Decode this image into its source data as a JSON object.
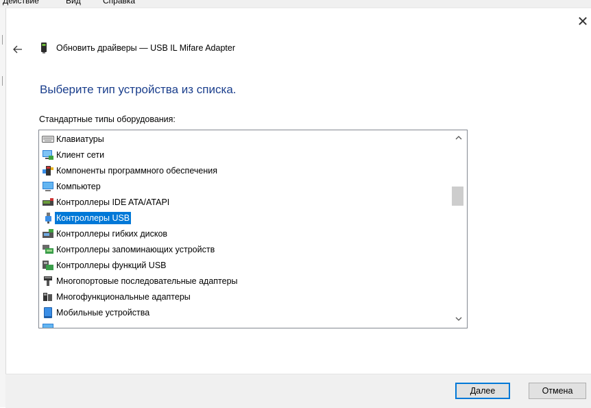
{
  "menubar": {
    "items": [
      "Действие",
      "Вид",
      "Справка"
    ]
  },
  "window": {
    "close_glyph": "✕"
  },
  "header": {
    "back_icon": "arrow-left-icon",
    "device_icon": "usb-device-icon",
    "title": "Обновить драйверы — USB IL Mifare Adapter"
  },
  "main": {
    "instruction": "Выберите тип устройства из списка.",
    "list_label": "Стандартные типы оборудования:",
    "selected_index": 5,
    "items": [
      {
        "label": "Клавиатуры",
        "icon": "keyboard-icon"
      },
      {
        "label": "Клиент сети",
        "icon": "network-client-icon"
      },
      {
        "label": "Компоненты программного обеспечения",
        "icon": "software-component-icon"
      },
      {
        "label": "Компьютер",
        "icon": "computer-icon"
      },
      {
        "label": "Контроллеры IDE ATA/ATAPI",
        "icon": "ide-controller-icon"
      },
      {
        "label": "Контроллеры USB",
        "icon": "usb-controller-icon"
      },
      {
        "label": "Контроллеры гибких дисков",
        "icon": "floppy-controller-icon"
      },
      {
        "label": "Контроллеры запоминающих устройств",
        "icon": "storage-controller-icon"
      },
      {
        "label": "Контроллеры функций USB",
        "icon": "usb-function-controller-icon"
      },
      {
        "label": "Многопортовые последовательные адаптеры",
        "icon": "multiport-serial-icon"
      },
      {
        "label": "Многофункциональные адаптеры",
        "icon": "multifunction-adapter-icon"
      },
      {
        "label": "Мобильные устройства",
        "icon": "mobile-device-icon"
      },
      {
        "label": "",
        "icon": "monitor-icon"
      }
    ]
  },
  "footer": {
    "next_label": "Далее",
    "cancel_label": "Отмена"
  },
  "colors": {
    "accent": "#0078d7",
    "instruction": "#1a3e8c"
  }
}
